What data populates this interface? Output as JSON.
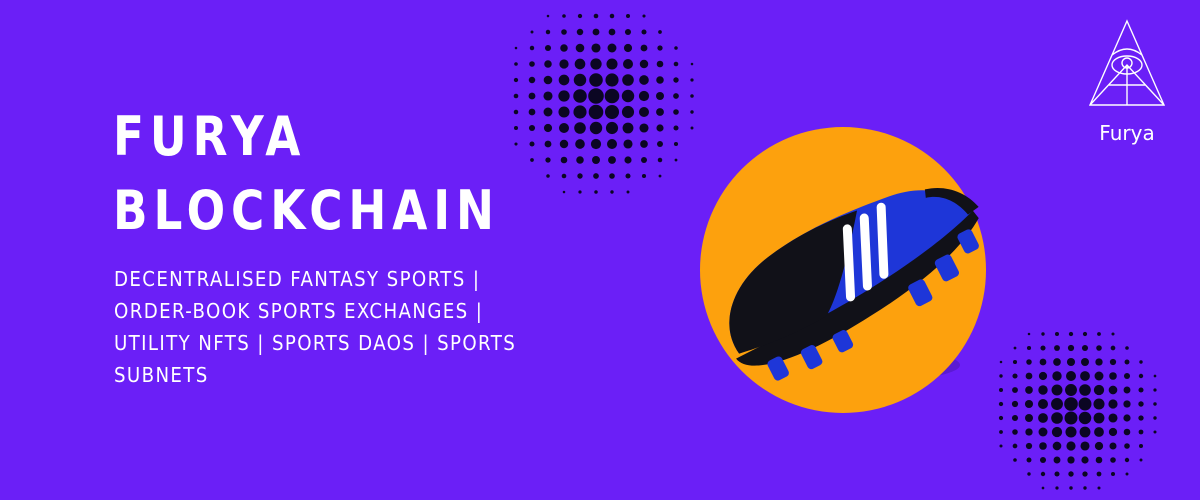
{
  "colors": {
    "background": "#6b1ff7",
    "accent_circle": "#fda10d",
    "dot": "#0b0623",
    "shoe_blue": "#1e36d8",
    "shoe_black": "#111118",
    "text": "#ffffff"
  },
  "headline": {
    "line1": "FURYA",
    "line2": "BLOCKCHAIN"
  },
  "tagline": {
    "line1": "DECENTRALISED FANTASY SPORTS |",
    "line2": "ORDER-BOOK SPORTS EXCHANGES |",
    "line3": "UTILITY NFTS | SPORTS DAOS | SPORTS",
    "line4": "SUBNETS"
  },
  "logo": {
    "icon": "furya-triangle-eye-icon",
    "text": "Furya"
  },
  "images": {
    "hero": "football-boot-image",
    "decor": "halftone-dots"
  }
}
